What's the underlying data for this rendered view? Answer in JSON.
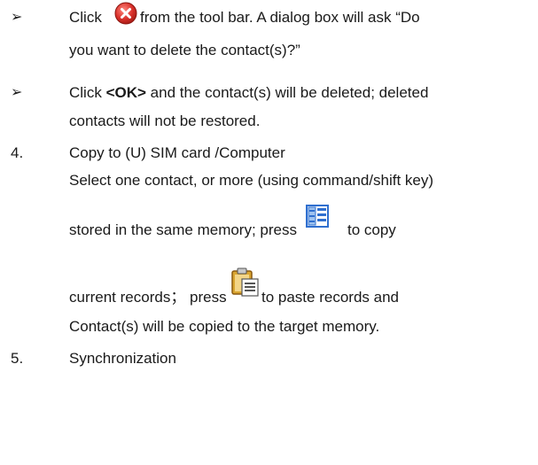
{
  "bullet_glyph": "➢",
  "items": {
    "delete_step": {
      "line1_before_icon": "Click",
      "line1_after_icon": "from the tool bar. A dialog box will ask “Do",
      "line2": "you want to delete the contact(s)?”"
    },
    "ok_step": {
      "line1_prefix": "Click",
      "ok_label": "<OK>",
      "line1_suffix": "and the contact(s) will be deleted; deleted",
      "line2": "contacts will not be restored."
    },
    "section4": {
      "number": "4.",
      "title": "Copy to (U) SIM card /Computer",
      "line1": "Select one contact, or more (using command/shift key)",
      "line2_before_icon": "stored in the same memory; press",
      "line2_after_icon": "to copy",
      "line3_before_icon": "current records； press",
      "line3_after_icon": "to paste records and",
      "line4": "Contact(s) will be copied to the target memory."
    },
    "section5": {
      "number": "5.",
      "title": "Synchronization"
    }
  },
  "icons": {
    "delete": "delete-icon",
    "copy": "copy-icon",
    "paste": "paste-icon"
  },
  "colors": {
    "delete_red": "#d9302a",
    "copy_blue": "#2f6fcf",
    "paste_gold": "#d9a531"
  }
}
